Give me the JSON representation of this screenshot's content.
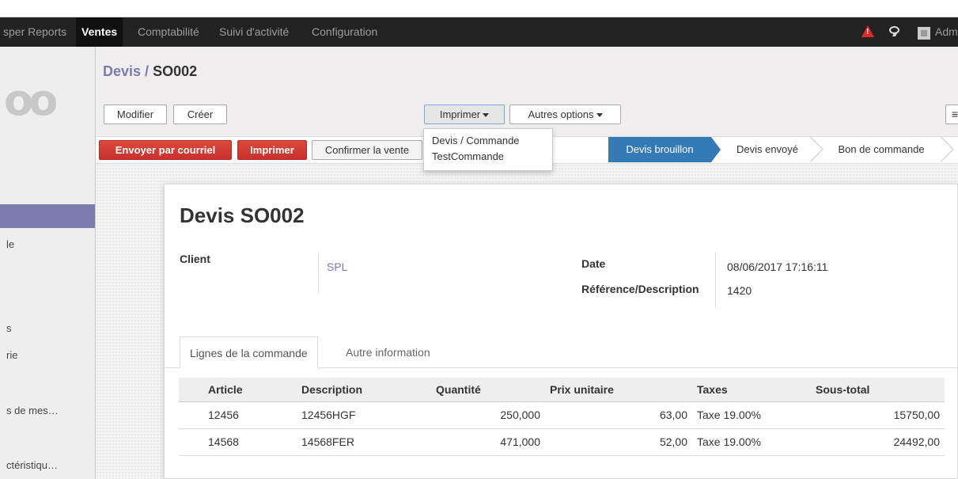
{
  "topbar": {
    "menus": [
      {
        "label": "sper Reports"
      },
      {
        "label": "Ventes"
      },
      {
        "label": "Comptabilité"
      },
      {
        "label": "Suivi d'activité"
      },
      {
        "label": "Configuration"
      }
    ],
    "user": "Adm",
    "alert_color": "#e02828"
  },
  "sidebar": {
    "items": [
      {
        "label": "le"
      },
      {
        "label": "s"
      },
      {
        "label": "rie"
      },
      {
        "label": "s de mes…"
      },
      {
        "label": "ctéristiqu…"
      }
    ]
  },
  "breadcrumb": {
    "parent": "Devis",
    "separator": " / ",
    "current": "SO002"
  },
  "toolbar": {
    "edit": "Modifier",
    "create": "Créer",
    "print": "Imprimer",
    "more": "Autres options"
  },
  "print_menu": {
    "items": [
      "Devis / Commande",
      "TestCommande"
    ]
  },
  "actions": {
    "send_email": "Envoyer par courriel",
    "print": "Imprimer",
    "confirm": "Confirmer la vente"
  },
  "statusbar": {
    "steps": [
      "Devis brouillon",
      "Devis envoyé",
      "Bon de commande"
    ],
    "active": "Devis brouillon",
    "active_color": "#337ab7"
  },
  "form": {
    "title": "Devis SO002",
    "client_label": "Client",
    "client_value": "SPL",
    "date_label": "Date",
    "date_value": "08/06/2017 17:16:11",
    "ref_label": "Référence/Description",
    "ref_value": "1420"
  },
  "tabs": [
    "Lignes de la commande",
    "Autre information"
  ],
  "lines": {
    "headers": [
      "Article",
      "Description",
      "Quantité",
      "Prix unitaire",
      "Taxes",
      "Sous-total"
    ],
    "rows": [
      [
        "12456",
        "12456HGF",
        "250,000",
        "63,00",
        "Taxe 19.00%",
        "15750,00"
      ],
      [
        "14568",
        "14568FER",
        "471,000",
        "52,00",
        "Taxe 19.00%",
        "24492,00"
      ]
    ]
  }
}
